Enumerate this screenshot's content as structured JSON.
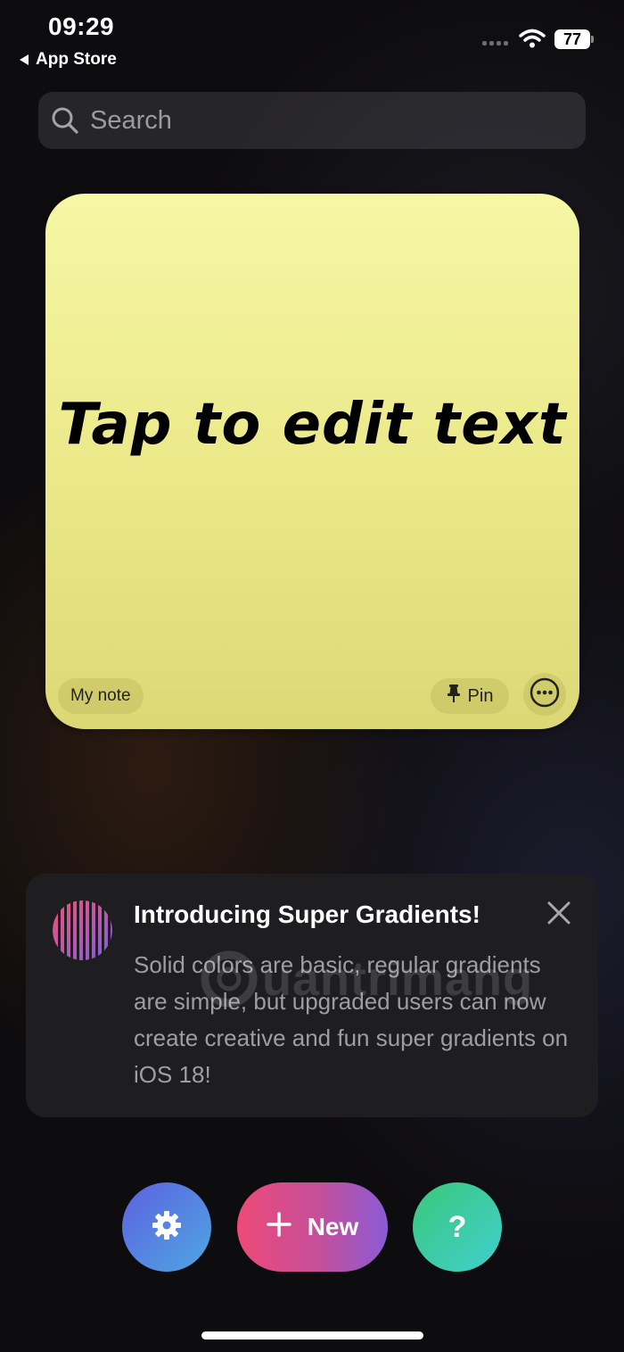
{
  "status_bar": {
    "time": "09:29",
    "back_label": "App Store",
    "battery": "77"
  },
  "search": {
    "placeholder": "Search"
  },
  "note": {
    "text": "Tap to edit text",
    "tag": "My note",
    "pin_label": "Pin",
    "color": "#f2f29d"
  },
  "promo": {
    "title": "Introducing Super Gradients!",
    "body": "Solid colors are basic, regular gradients are simple, but upgraded users can now create creative and fun super gradients on iOS 18!",
    "watermark": "uantrimang"
  },
  "actions": {
    "new_label": "New",
    "help_label": "?"
  },
  "colors": {
    "settings_gradient": [
      "#5c62e0",
      "#4fa6e2"
    ],
    "new_gradient": [
      "#ee4a78",
      "#8a5bd6"
    ],
    "help_gradient": [
      "#3bc77a",
      "#3fd0cf"
    ]
  },
  "icons": [
    "back-arrow-icon",
    "wifi-icon",
    "battery-icon",
    "search-icon",
    "pin-icon",
    "more-icon",
    "close-icon",
    "gear-icon",
    "plus-icon"
  ]
}
